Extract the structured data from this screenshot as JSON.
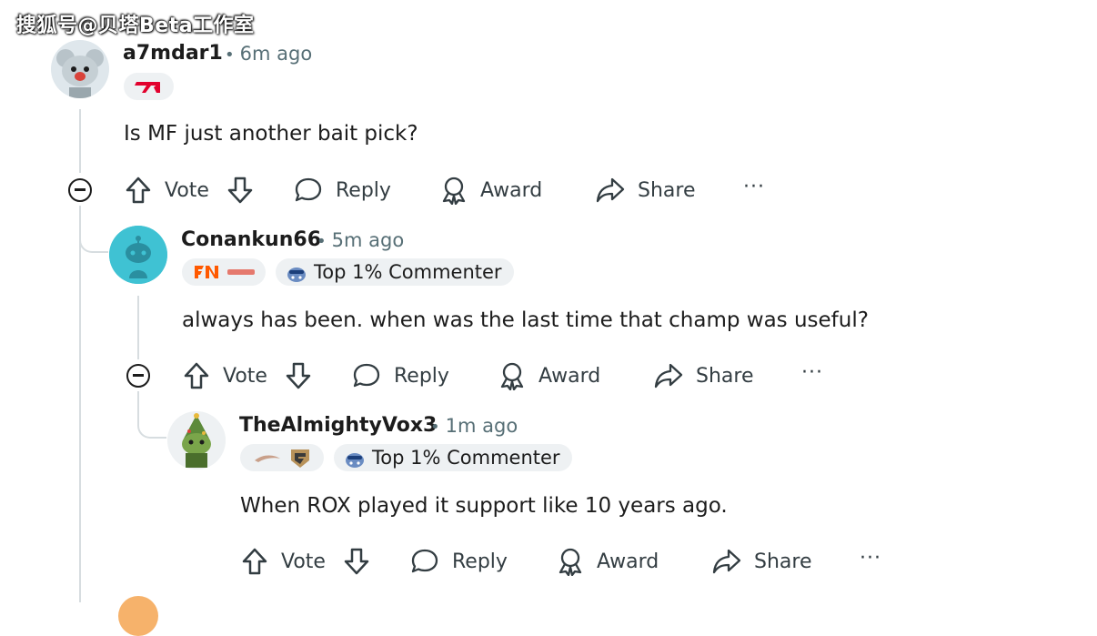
{
  "watermark": "搜狐号@贝塔Beta工作室",
  "comments": [
    {
      "username": "a7mdar1",
      "time": "6m ago",
      "text": "Is MF just another bait pick?",
      "achievement": null
    },
    {
      "username": "Conankun66",
      "time": "5m ago",
      "text": "always has been. when was the last time that champ was useful?",
      "achievement": "Top 1% Commenter"
    },
    {
      "username": "TheAlmightyVox3",
      "time": "1m ago",
      "text": "When ROX played it support like 10 years ago.",
      "achievement": "Top 1% Commenter"
    }
  ],
  "actions": {
    "vote": "Vote",
    "reply": "Reply",
    "award": "Award",
    "share": "Share",
    "more": "···"
  },
  "colors": {
    "t1_red": "#e2012d",
    "fnatic_orange": "#ff5900",
    "avatar_cyan": "#3fc2d3",
    "thread_line": "#d7dde0"
  }
}
